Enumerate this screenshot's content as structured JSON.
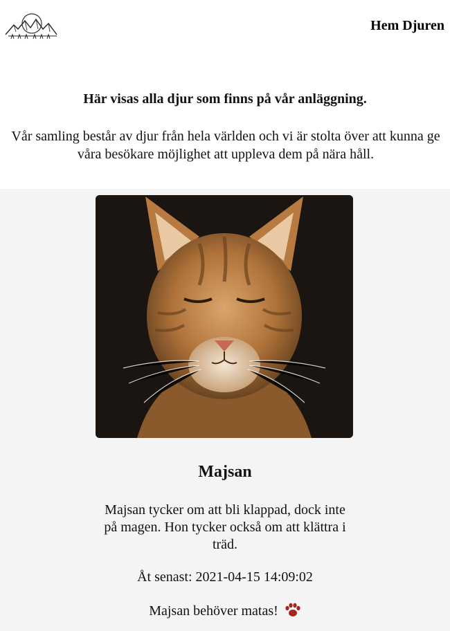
{
  "header": {
    "logo_icon": "mountain-logo-icon",
    "nav": [
      {
        "label": "Hem"
      },
      {
        "label": "Djuren"
      }
    ]
  },
  "intro": {
    "heading": "Här visas alla djur som finns på vår anläggning.",
    "text": "Vår samling består av djur från hela världen och vi är stolta över att kunna ge våra besökare möjlighet att uppleva dem på nära håll."
  },
  "animal": {
    "image_alt": "cat-photo",
    "name": "Majsan",
    "description": "Majsan tycker om att bli klappad, dock inte på magen. Hon tycker också om att klättra i träd.",
    "last_fed_label": "Åt senast: 2021-04-15 14:09:02",
    "feed_text": "Majsan behöver matas!",
    "feed_icon": "paw-icon"
  },
  "colors": {
    "gallery_bg": "#f4f4f4",
    "paw": "#a3261f"
  }
}
